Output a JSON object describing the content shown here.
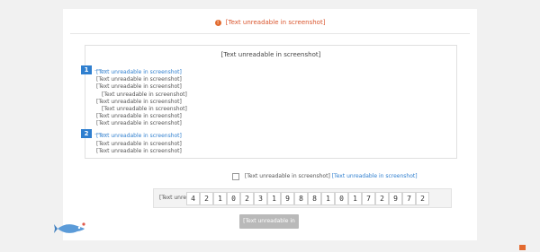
{
  "notice": {
    "text": "[Text unreadable in screenshot]",
    "icon": "warning-icon",
    "color": "#d9542c"
  },
  "guide": {
    "title": "[Text unreadable in screenshot]",
    "section1": {
      "number": "1",
      "heading": "[Text unreadable in screenshot]",
      "lines": [
        "[Text unreadable in screenshot]",
        "[Text unreadable in screenshot]",
        "[Text unreadable in screenshot]",
        "[Text unreadable in screenshot]",
        "[Text unreadable in screenshot]",
        "[Text unreadable in screenshot]",
        "[Text unreadable in screenshot]"
      ]
    },
    "section2": {
      "number": "2",
      "heading": "[Text unreadable in screenshot]",
      "lines": [
        "[Text unreadable in screenshot]",
        "[Text unreadable in screenshot]"
      ]
    }
  },
  "agreement": {
    "prefix": "[Text unreadable in screenshot]",
    "link": "[Text unreadable in screenshot]"
  },
  "id_card": {
    "label": "[Text unreadable in screenshot]",
    "digits": [
      "4",
      "2",
      "1",
      "0",
      "2",
      "3",
      "1",
      "9",
      "8",
      "8",
      "1",
      "0",
      "1",
      "7",
      "2",
      "9",
      "7",
      "2"
    ]
  },
  "submit": {
    "label": "[Text unreadable in screenshot]"
  },
  "colors": {
    "accent": "#2f7fcf",
    "warning": "#d9542c",
    "button": "#b9b9b9"
  }
}
